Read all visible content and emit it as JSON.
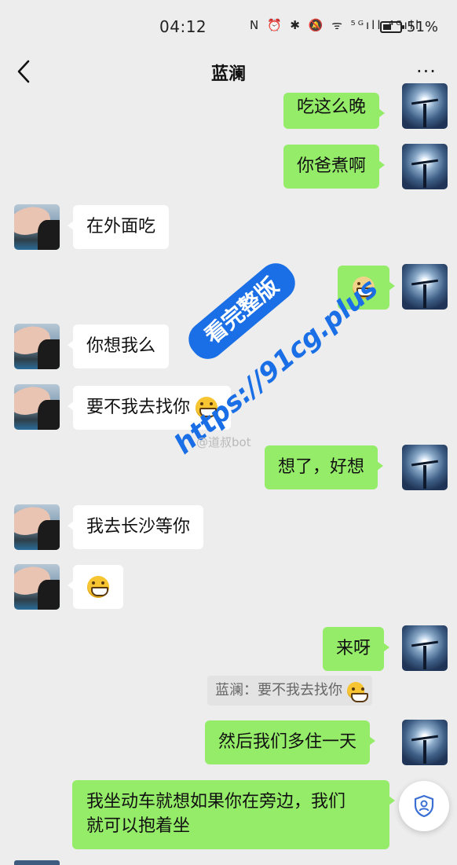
{
  "status_bar": {
    "time": "04:12",
    "icons": "N ⏰ ✱ 🔕 ᯤ ⁵ᴳıll ⁴ᴳıll",
    "battery": "51%"
  },
  "header": {
    "title": "蓝澜",
    "more": "···"
  },
  "messages": [
    {
      "from": "me",
      "text": "吃这么晚"
    },
    {
      "from": "me",
      "text": "你爸煮啊"
    },
    {
      "from": "her",
      "text": "在外面吃"
    },
    {
      "from": "me",
      "text": "",
      "emoji": "doge-emoji"
    },
    {
      "from": "her",
      "text": "你想我么"
    },
    {
      "from": "her",
      "text": "要不我去找你",
      "emoji": "grin-emoji"
    },
    {
      "from": "me",
      "text": "想了，好想"
    },
    {
      "from": "her",
      "text": "我去长沙等你"
    },
    {
      "from": "her",
      "text": "",
      "emoji": "grin-emoji"
    },
    {
      "from": "me",
      "text": "来呀"
    },
    {
      "from": "me",
      "text": "然后我们多住一天"
    },
    {
      "from": "her",
      "text": "我坐动车就想如果你在旁边，我们就可以抱着坐"
    }
  ],
  "quote": {
    "text": "蓝澜：要不我去找你"
  },
  "watermark": {
    "badge": "看完整版",
    "url": "https://91cg.plus",
    "weibo": "@道叔bot"
  },
  "multiline": {
    "line1": "我坐动车就想如果你在旁边，我们",
    "line2": "就可以抱着坐"
  },
  "colors": {
    "background": "#ededed",
    "my_bubble": "#95ec69",
    "her_bubble": "#ffffff",
    "watermark_blue": "#1a6fe6"
  }
}
